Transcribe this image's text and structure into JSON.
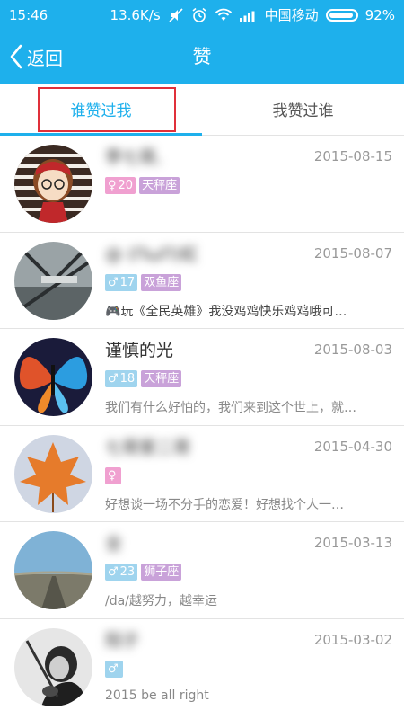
{
  "status_bar": {
    "time": "15:46",
    "network_speed": "13.6K/s",
    "carrier": "中国移动",
    "battery": "92%"
  },
  "header": {
    "back_label": "返回",
    "title": "赞"
  },
  "tabs": [
    {
      "label": "谁赞过我",
      "active": true
    },
    {
      "label": "我赞过谁",
      "active": false
    }
  ],
  "items": [
    {
      "name": "李七哥,",
      "date": "2015-08-15",
      "gender": "female",
      "age": "20",
      "zodiac": "天秤座",
      "signature": ""
    },
    {
      "name": "@ (ΠωΠ)虹",
      "date": "2015-08-07",
      "gender": "male",
      "age": "17",
      "zodiac": "双鱼座",
      "signature": "🎮玩《全民英雄》我没鸡鸡快乐鸡鸡哦可…"
    },
    {
      "name": "谨慎的光",
      "date": "2015-08-03",
      "gender": "male",
      "age": "18",
      "zodiac": "天秤座",
      "signature": "我们有什么好怕的，我们来到这个世上，就…"
    },
    {
      "name": "七哥爱二哥",
      "date": "2015-04-30",
      "gender": "female",
      "age": "",
      "zodiac": "",
      "signature": "好想谈一场不分手的恋爱！好想找个人一…"
    },
    {
      "name": "全",
      "date": "2015-03-13",
      "gender": "male",
      "age": "23",
      "zodiac": "狮子座",
      "signature": "/da/越努力，越幸运"
    },
    {
      "name": "阳子",
      "date": "2015-03-02",
      "gender": "male",
      "age": "",
      "zodiac": "",
      "signature": "2015 be all right"
    }
  ],
  "colors": {
    "accent": "#1eb0ec",
    "female_tag": "#f0a0d0",
    "male_tag": "#9fd4ee",
    "zodiac_tag": "#c9a2d9",
    "highlight_box": "#e0303a"
  }
}
